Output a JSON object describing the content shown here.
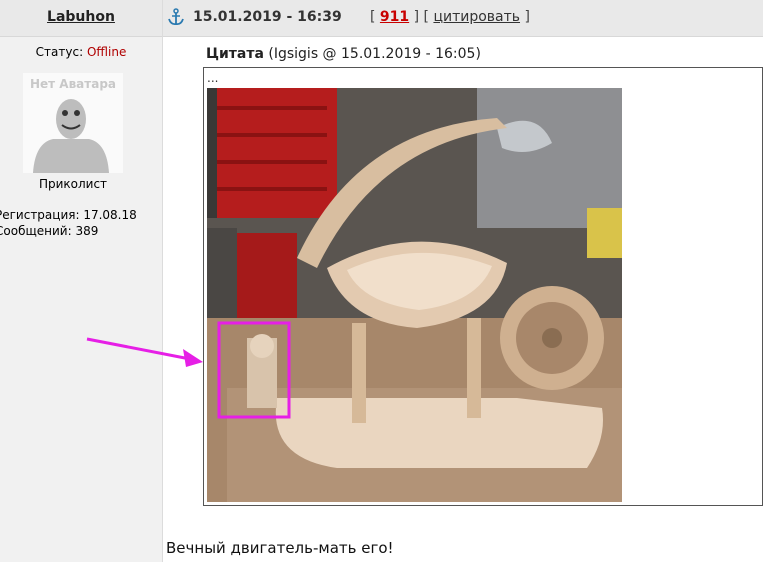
{
  "user": {
    "name": "Labuhon",
    "status_label": "Статус: ",
    "status_value": "Offline",
    "avatar_text": "Нет Аватара",
    "rank": "Приколист",
    "reg_line": "Регистрация: 17.08.18",
    "posts_line": "Сообщений: 389"
  },
  "post": {
    "datetime": "15.01.2019 - 16:39",
    "bracket_open": "[",
    "number": "911",
    "bracket_mid": "] [",
    "quote_action": "цитировать",
    "bracket_close": "]",
    "quote_label": "Цитата",
    "quote_meta": "(Igsigis @ 15.01.2019 - 16:05)",
    "quote_ellipsis": "...",
    "text": "Вечный двигатель-мать его!"
  },
  "colors": {
    "status_offline": "#b00000",
    "post_number": "#c80000",
    "highlight": "#e61fe6"
  }
}
